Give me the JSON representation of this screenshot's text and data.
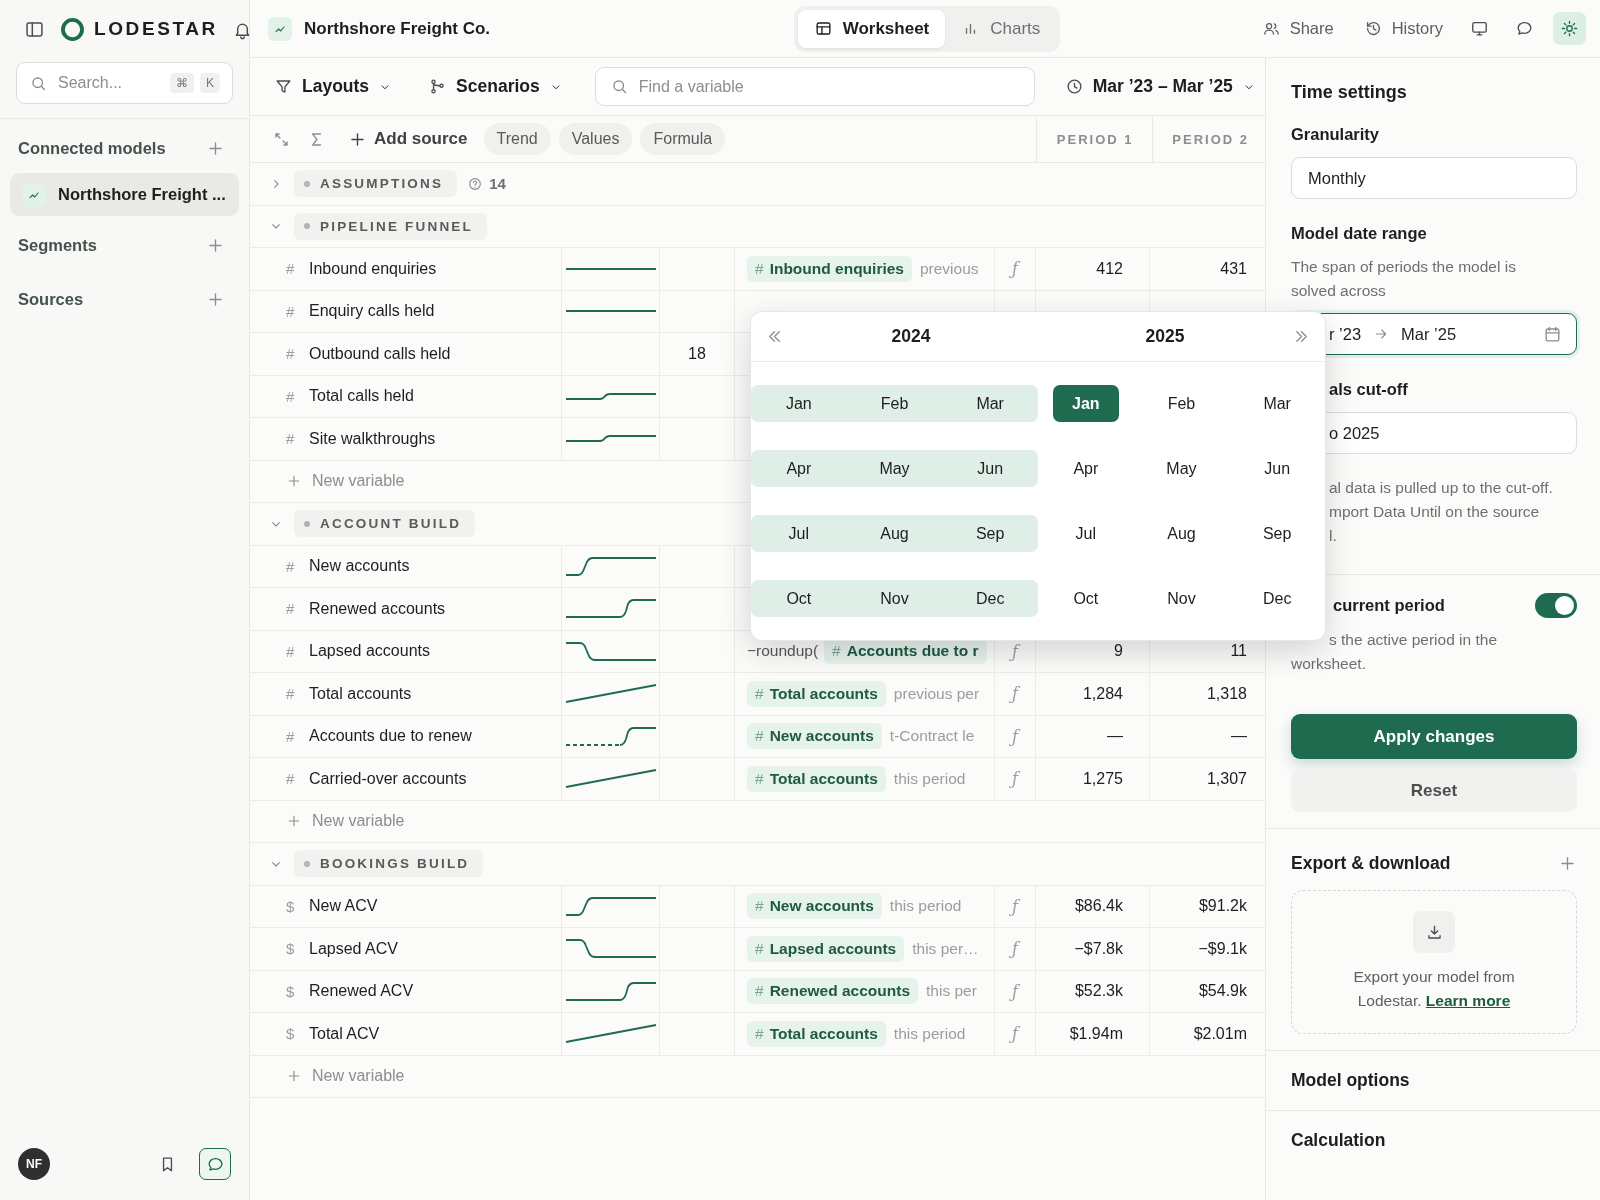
{
  "sidebar": {
    "brand": "LODESTAR",
    "search": {
      "placeholder": "Search...",
      "shortcut": [
        "⌘",
        "K"
      ]
    },
    "sections": [
      {
        "title": "Connected models",
        "items": [
          {
            "label": "Northshore Freight ...",
            "selected": true
          }
        ]
      },
      {
        "title": "Segments"
      },
      {
        "title": "Sources"
      }
    ],
    "user": {
      "initials": "NF"
    },
    "footer_icons": [
      {
        "active": false
      },
      {
        "active": true
      }
    ]
  },
  "topbar": {
    "model_title": "Northshore Freight Co.",
    "views": [
      {
        "label": "Worksheet",
        "selected": true
      },
      {
        "label": "Charts",
        "selected": false
      }
    ],
    "actions": [
      {
        "label": "Share"
      },
      {
        "label": "History"
      }
    ],
    "icon_buttons": [
      {
        "active": false
      },
      {
        "active": false
      },
      {
        "active": true
      }
    ]
  },
  "toolbar": {
    "layouts": "Layouts",
    "scenarios": "Scenarios",
    "search": {
      "placeholder": "Find a variable"
    },
    "date_range": "Mar ’23 – Mar ’25",
    "add_source": "Add source",
    "chips": [
      "Trend",
      "Values",
      "Formula"
    ],
    "columns": [
      "PERIOD 1",
      "PERIOD 2"
    ]
  },
  "groups": [
    {
      "label": "ASSUMPTIONS",
      "expanded": false,
      "count": "14"
    },
    {
      "label": "PIPELINE FUNNEL",
      "expanded": true,
      "new_row": "New variable",
      "rows": [
        {
          "symbol": "#",
          "name": "Inbound enquiries",
          "kind": "flat",
          "formula": {
            "ref_symbol": "#",
            "ref": "Inbound enquiries",
            "tail": "previous",
            "fn": "ƒ"
          },
          "period_1": "412",
          "period_2": "431"
        },
        {
          "symbol": "#",
          "name": "Enquiry calls held",
          "kind": "flat"
        },
        {
          "symbol": "#",
          "name": "Outbound calls held",
          "kind": "value",
          "value": "18"
        },
        {
          "symbol": "#",
          "name": "Total calls held",
          "kind": "small_step"
        },
        {
          "symbol": "#",
          "name": "Site walkthroughs",
          "kind": "small_step"
        }
      ]
    },
    {
      "label": "ACCOUNT BUILD",
      "expanded": true,
      "new_row": "New variable",
      "rows": [
        {
          "symbol": "#",
          "name": "New accounts",
          "kind": "step_up"
        },
        {
          "symbol": "#",
          "name": "Renewed accounts",
          "kind": "step_up_late"
        },
        {
          "symbol": "#",
          "name": "Lapsed accounts",
          "kind": "step_down",
          "formula": {
            "prefix": "−roundup(",
            "ref_symbol": "#",
            "ref": "Accounts due to r",
            "fn": "ƒ"
          },
          "period_1": "9",
          "period_2": "11"
        },
        {
          "symbol": "#",
          "name": "Total accounts",
          "kind": "ramp",
          "formula": {
            "ref_symbol": "#",
            "ref": "Total accounts",
            "tail": "previous per",
            "fn": "ƒ"
          },
          "period_1": "1,284",
          "period_2": "1,318"
        },
        {
          "symbol": "#",
          "name": "Accounts due to renew",
          "kind": "dashed_step",
          "formula": {
            "ref_symbol": "#",
            "ref": "New accounts",
            "tail": "t-Contract le",
            "fn": "ƒ"
          },
          "period_1": "—",
          "period_2": "—"
        },
        {
          "symbol": "#",
          "name": "Carried-over accounts",
          "kind": "ramp",
          "formula": {
            "ref_symbol": "#",
            "ref": "Total accounts",
            "tail": "this period",
            "fn": "ƒ"
          },
          "period_1": "1,275",
          "period_2": "1,307"
        }
      ]
    },
    {
      "label": "BOOKINGS BUILD",
      "expanded": true,
      "new_row": "New variable",
      "rows": [
        {
          "symbol": "$",
          "name": "New ACV",
          "kind": "step_up",
          "formula": {
            "ref_symbol": "#",
            "ref": "New accounts",
            "tail": "this period",
            "fn": "ƒ"
          },
          "period_1": "$86.4k",
          "period_2": "$91.2k"
        },
        {
          "symbol": "$",
          "name": "Lapsed ACV",
          "kind": "step_down",
          "formula": {
            "ref_symbol": "#",
            "ref": "Lapsed accounts",
            "tail": "this per…",
            "fn": "ƒ"
          },
          "period_1": "−$7.8k",
          "period_2": "−$9.1k"
        },
        {
          "symbol": "$",
          "name": "Renewed ACV",
          "kind": "step_up_late",
          "formula": {
            "ref_symbol": "#",
            "ref": "Renewed accounts",
            "tail": "this per",
            "fn": "ƒ"
          },
          "period_1": "$52.3k",
          "period_2": "$54.9k"
        },
        {
          "symbol": "$",
          "name": "Total ACV",
          "kind": "ramp",
          "formula": {
            "ref_symbol": "#",
            "ref": "Total accounts",
            "tail": "this period",
            "fn": "ƒ"
          },
          "period_1": "$1.94m",
          "period_2": "$2.01m"
        }
      ]
    }
  ],
  "popover": {
    "years": [
      {
        "label": "2024",
        "months": [
          {
            "label": "Jan",
            "in_range": true,
            "selected": false
          },
          {
            "label": "Feb",
            "in_range": true,
            "selected": false
          },
          {
            "label": "Mar",
            "in_range": true,
            "selected": false
          },
          {
            "label": "Apr",
            "in_range": true,
            "selected": false
          },
          {
            "label": "May",
            "in_range": true,
            "selected": false
          },
          {
            "label": "Jun",
            "in_range": true,
            "selected": false
          },
          {
            "label": "Jul",
            "in_range": true,
            "selected": false
          },
          {
            "label": "Aug",
            "in_range": true,
            "selected": false
          },
          {
            "label": "Sep",
            "in_range": true,
            "selected": false
          },
          {
            "label": "Oct",
            "in_range": true,
            "selected": false
          },
          {
            "label": "Nov",
            "in_range": true,
            "selected": false
          },
          {
            "label": "Dec",
            "in_range": true,
            "selected": false
          }
        ]
      },
      {
        "label": "2025",
        "months": [
          {
            "label": "Jan",
            "in_range": false,
            "selected": true
          },
          {
            "label": "Feb",
            "in_range": false,
            "selected": false
          },
          {
            "label": "Mar",
            "in_range": false,
            "selected": false
          },
          {
            "label": "Apr",
            "in_range": false,
            "selected": false
          },
          {
            "label": "May",
            "in_range": false,
            "selected": false
          },
          {
            "label": "Jun",
            "in_range": false,
            "selected": false
          },
          {
            "label": "Jul",
            "in_range": false,
            "selected": false
          },
          {
            "label": "Aug",
            "in_range": false,
            "selected": false
          },
          {
            "label": "Sep",
            "in_range": false,
            "selected": false
          },
          {
            "label": "Oct",
            "in_range": false,
            "selected": false
          },
          {
            "label": "Nov",
            "in_range": false,
            "selected": false
          },
          {
            "label": "Dec",
            "in_range": false,
            "selected": false
          }
        ]
      }
    ]
  },
  "panel": {
    "title": "Time settings",
    "granularity": {
      "label": "Granularity",
      "value": "Monthly"
    },
    "date_range": {
      "label": "Model date range",
      "help": "The span of periods the model is solved across",
      "start": "r ’23",
      "end": "Mar ’25"
    },
    "cutoff": {
      "label": "als cut-off",
      "value": "o 2025",
      "help_lines": [
        "al data is pulled up to the cut-off.",
        "mport Data Until on the source",
        "l."
      ]
    },
    "current_period": {
      "label": "current period",
      "on": true,
      "help_lines": [
        "s the active period in the",
        "worksheet."
      ]
    },
    "apply": "Apply changes",
    "reset": "Reset",
    "export": {
      "title": "Export & download",
      "text": "Export your model from Lodestar.",
      "link": "Learn more"
    },
    "sections": [
      "Model options",
      "Calculation"
    ]
  }
}
